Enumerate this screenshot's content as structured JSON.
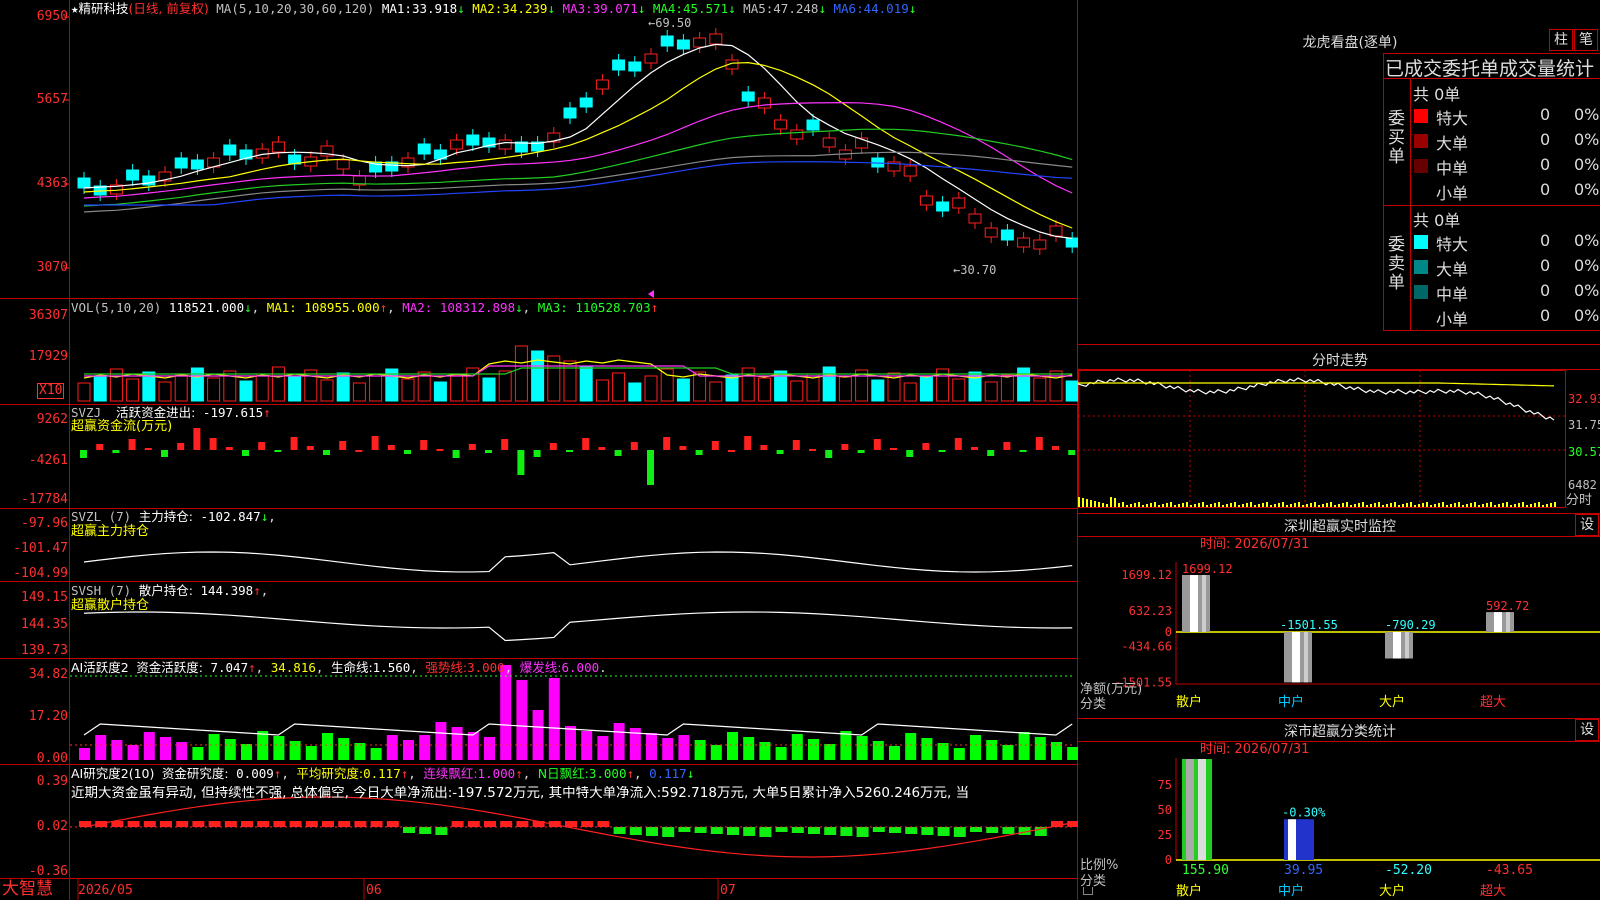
{
  "colors": {
    "up": "#ff2020",
    "down": "#00ffff",
    "ma1": "#ffffff",
    "ma2": "#ffff00",
    "ma3": "#ff33ff",
    "ma4": "#22cc22",
    "ma5": "#888888",
    "ma6": "#2244ff",
    "panel_border": "#c00000",
    "bar_up": "#ff00ff",
    "bar_down": "#00ff00"
  },
  "logo": "大智慧",
  "kline": {
    "title_star": "★",
    "stock": "精研科技",
    "mode": "(日线, 前复权)",
    "ma_label": "MA(5,10,20,30,60,120)",
    "ma": [
      {
        "name": "MA1:",
        "value": "33.918",
        "arrow": "↓"
      },
      {
        "name": "MA2:",
        "value": "34.239",
        "arrow": "↓"
      },
      {
        "name": "MA3:",
        "value": "39.071",
        "arrow": "↓"
      },
      {
        "name": "MA4:",
        "value": "45.571",
        "arrow": "↓"
      },
      {
        "name": "MA5:",
        "value": "47.248",
        "arrow": "↓"
      },
      {
        "name": "MA6:",
        "value": "44.019",
        "arrow": "↓"
      }
    ],
    "yaxis": [
      "6950",
      "5657",
      "4363",
      "3070"
    ],
    "high_label": "←69.50",
    "low_label": "←30.70"
  },
  "vol": {
    "name": "VOL(5,10,20)",
    "value": "118521.000",
    "arrow": "↓",
    "ma": [
      {
        "name": "MA1:",
        "value": "108955.000",
        "arrow": "↑"
      },
      {
        "name": "MA2:",
        "value": "108312.898",
        "arrow": "↓"
      },
      {
        "name": "MA3:",
        "value": "110528.703",
        "arrow": "↑"
      }
    ],
    "yaxis": [
      "36307",
      "17929"
    ],
    "unit": "X10"
  },
  "svzj": {
    "name": "SVZJ",
    "desc": "活跃资金进出:",
    "value": "-197.615",
    "arrow": "↑",
    "sub": "超赢资金流(万元)",
    "yaxis": [
      "9262",
      "-4261",
      "-17784"
    ]
  },
  "svzl": {
    "name": "SVZL (7)",
    "desc": "主力持仓:",
    "value": "-102.847",
    "arrow": "↓",
    "sub": "超赢主力持仓",
    "yaxis": [
      "-97.96",
      "-101.47",
      "-104.99"
    ]
  },
  "svsh": {
    "name": "SVSH (7)",
    "desc": "散户持仓:",
    "value": "144.398",
    "arrow": "↑",
    "sub": "超赢散户持仓",
    "yaxis": [
      "149.15",
      "144.35",
      "139.73"
    ]
  },
  "ai1": {
    "name": "AI活跃度2",
    "desc": "资金活跃度:",
    "value": "7.047",
    "arrow": "↑",
    "v2": "34.816",
    "life_label": "生命线:",
    "life": "1.560",
    "strong_label": "强势线:",
    "strong": "3.000",
    "burst_label": "爆发线:",
    "burst": "6.000",
    "yaxis": [
      "34.82",
      "17.20",
      "0.00"
    ]
  },
  "ai2": {
    "name": "AI研究度2(10)",
    "desc": "资金研究度:",
    "value": "0.009",
    "arrow": "↑",
    "avg_label": "平均研究度:",
    "avg": "0.117",
    "avg_arrow": "↑",
    "streak_label": "连续飘红:",
    "streak": "1.000",
    "streak_arrow": "↑",
    "nday_label": "N日飘红:",
    "nday": "3.000",
    "nday_arrow": "↑",
    "last": "0.117",
    "last_arrow": "↓",
    "comment": "近期大资金虽有异动, 但持续性不强, 总体偏空, 今日大单净流出:-197.572万元, 其中特大单净流入:592.718万元, 大单5日累计净入5260.246万元, 当",
    "yaxis": [
      "0.39",
      "0.02",
      "-0.36"
    ]
  },
  "xaxis": [
    "2026/05",
    "06",
    "07"
  ],
  "dragon": {
    "title": "龙虎看盘(逐单)",
    "btn1": "柱",
    "btn2": "笔",
    "tabs": "已成交委托单成交量统计",
    "buy_label": "委买单",
    "sell_label": "委卖单",
    "buy_total": "共 0单",
    "sell_total": "共 0单",
    "rows": [
      {
        "name": "特大",
        "count": "0",
        "pct": "0%"
      },
      {
        "name": "大单",
        "count": "0",
        "pct": "0%"
      },
      {
        "name": "中单",
        "count": "0",
        "pct": "0%"
      },
      {
        "name": "小单",
        "count": "0",
        "pct": "0%"
      }
    ]
  },
  "intraday": {
    "title": "分时走势",
    "yaxis": [
      "32.93",
      "31.75",
      "30.57"
    ],
    "vol_top": "6482",
    "vol_unit": "分时"
  },
  "monitor": {
    "title": "深圳超赢实时监控",
    "btn": "设",
    "time": "时间: 2026/07/31",
    "yaxis": [
      "1699.12",
      "632.23",
      "0",
      "-434.66",
      "-1501.55"
    ],
    "ylabel": "净额(万元)",
    "xcap": "分类",
    "categories": [
      "散户",
      "中户",
      "大户",
      "超大"
    ],
    "values": [
      1699.12,
      -1501.55,
      -790.29,
      592.72
    ],
    "value_labels": [
      "1699.12",
      "-1501.55",
      "-790.29",
      "592.72"
    ]
  },
  "stats": {
    "title": "深市超赢分类统计",
    "btn": "设",
    "time": "时间: 2026/07/31",
    "yaxis": [
      "75",
      "50",
      "25",
      "0"
    ],
    "ylabel": "比例%",
    "xcap": "分类",
    "categories": [
      "散户",
      "中户",
      "大户",
      "超大"
    ],
    "bar_values": [
      99,
      39.95,
      0,
      0
    ],
    "bar_label": "-0.30%",
    "bottom_values": [
      "155.90",
      "39.95",
      "-52.20",
      "-43.65"
    ]
  }
}
